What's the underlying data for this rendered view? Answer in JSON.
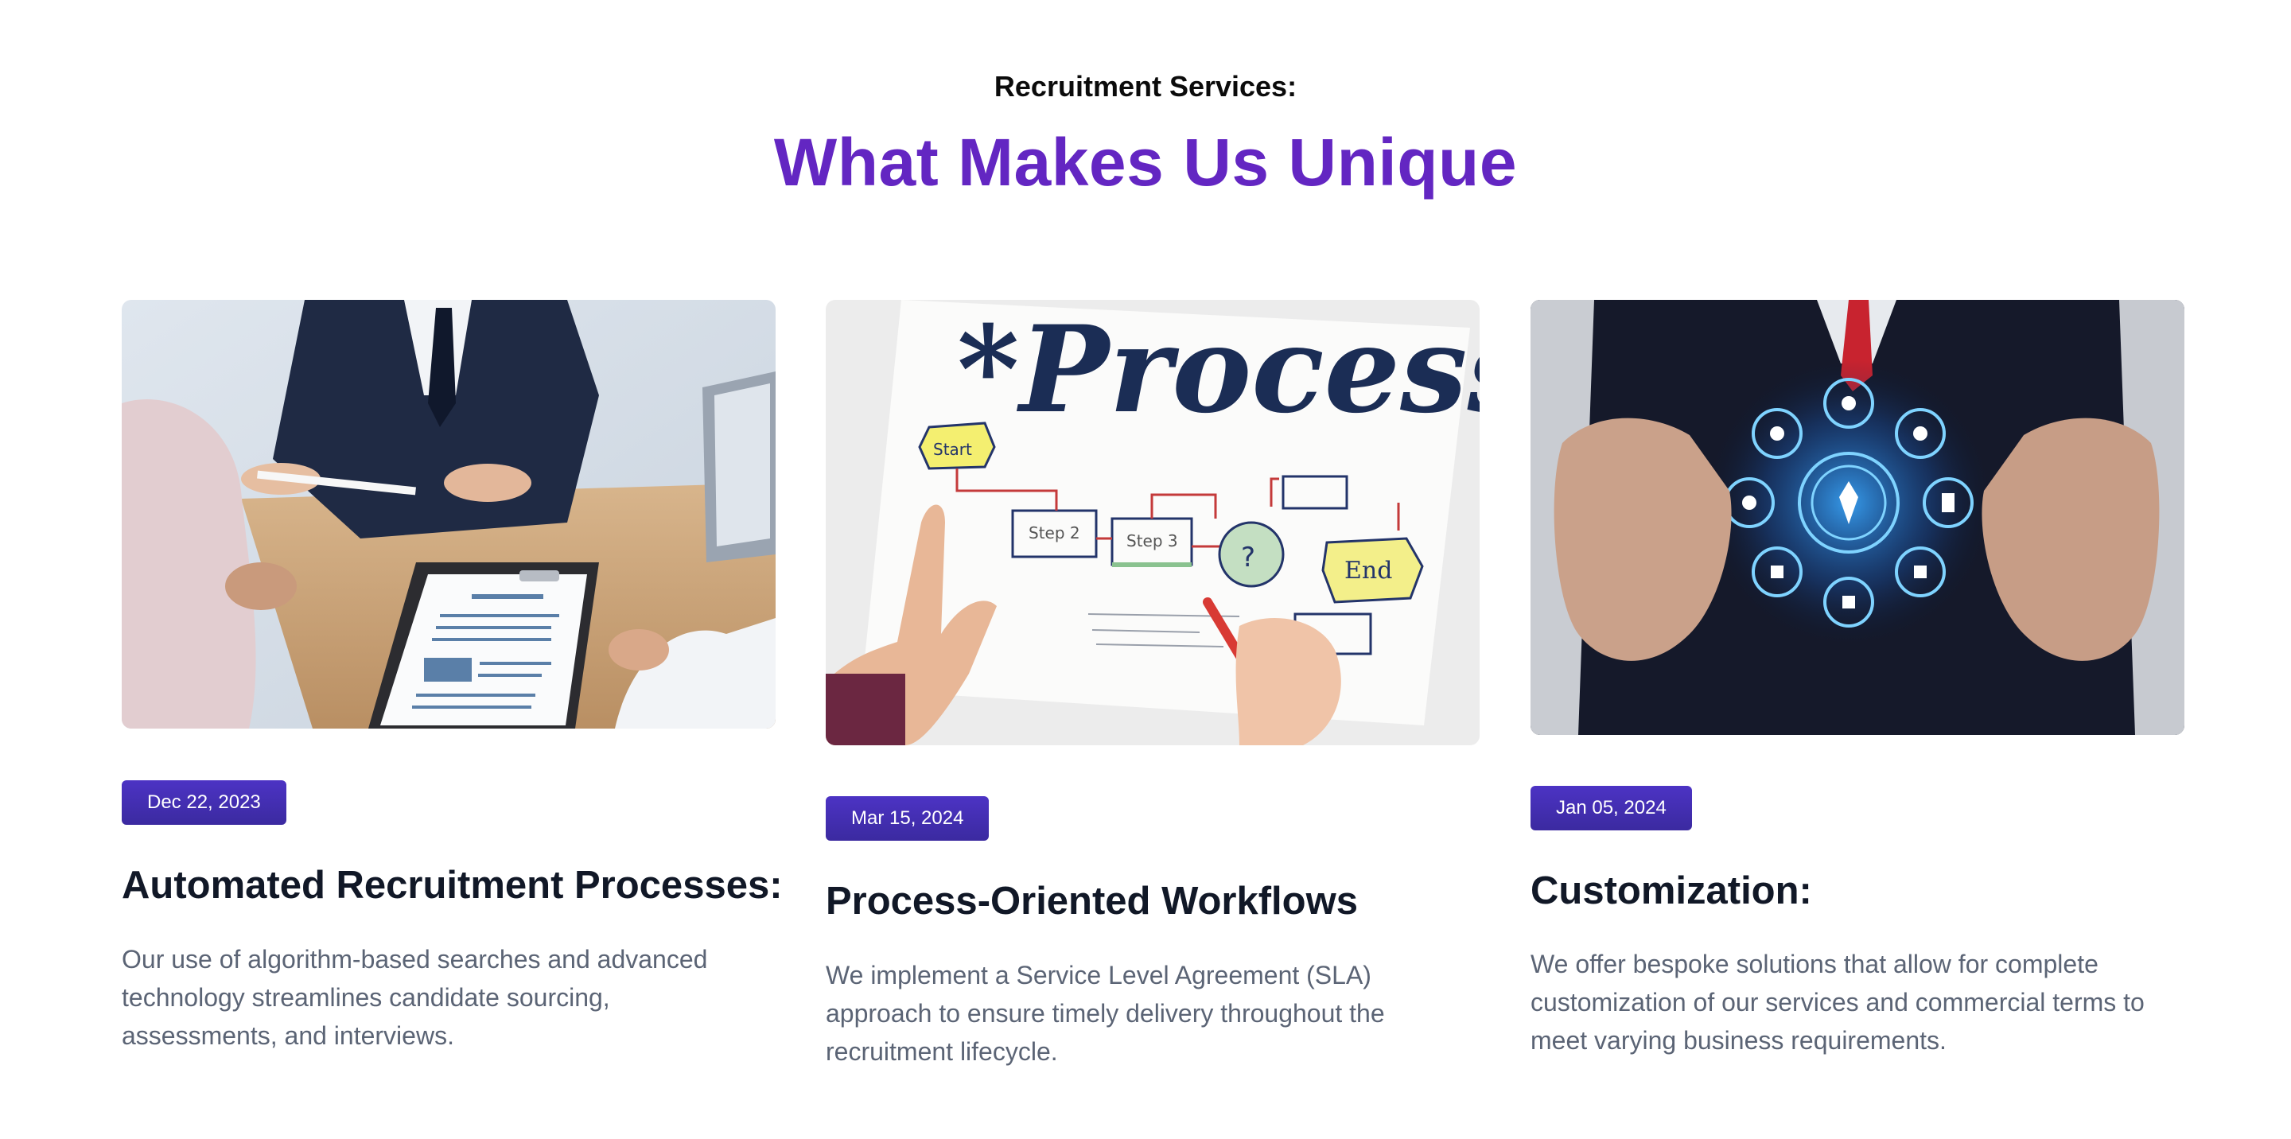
{
  "section": {
    "eyebrow": "Recruitment Services:",
    "heading": "What Makes Us Unique"
  },
  "cards": [
    {
      "date": "Dec 22, 2023",
      "title": "Automated Recruitment Processes:",
      "description": "Our use of algorithm-based searches and advanced technology streamlines candidate sourcing, assessments, and interviews.",
      "image": "interview-meeting-photo"
    },
    {
      "date": "Mar 15, 2024",
      "title": "Process-Oriented Workflows",
      "description": "We implement a Service Level Agreement (SLA) approach to ensure timely delivery throughout the recruitment lifecycle.",
      "image": "process-flowchart-photo",
      "image_text": {
        "headline": "*Process",
        "start": "Start",
        "step2": "Step 2",
        "step3": "Step 3",
        "question": "?",
        "end": "End"
      }
    },
    {
      "date": "Jan 05, 2024",
      "title": "Customization:",
      "description": "We offer bespoke solutions that allow for complete customization of our services and commercial terms to meet varying business requirements.",
      "image": "digital-network-icons-photo"
    }
  ],
  "colors": {
    "heading": "#6326c2",
    "badge": "#4c33c4",
    "description": "#5b6475"
  }
}
